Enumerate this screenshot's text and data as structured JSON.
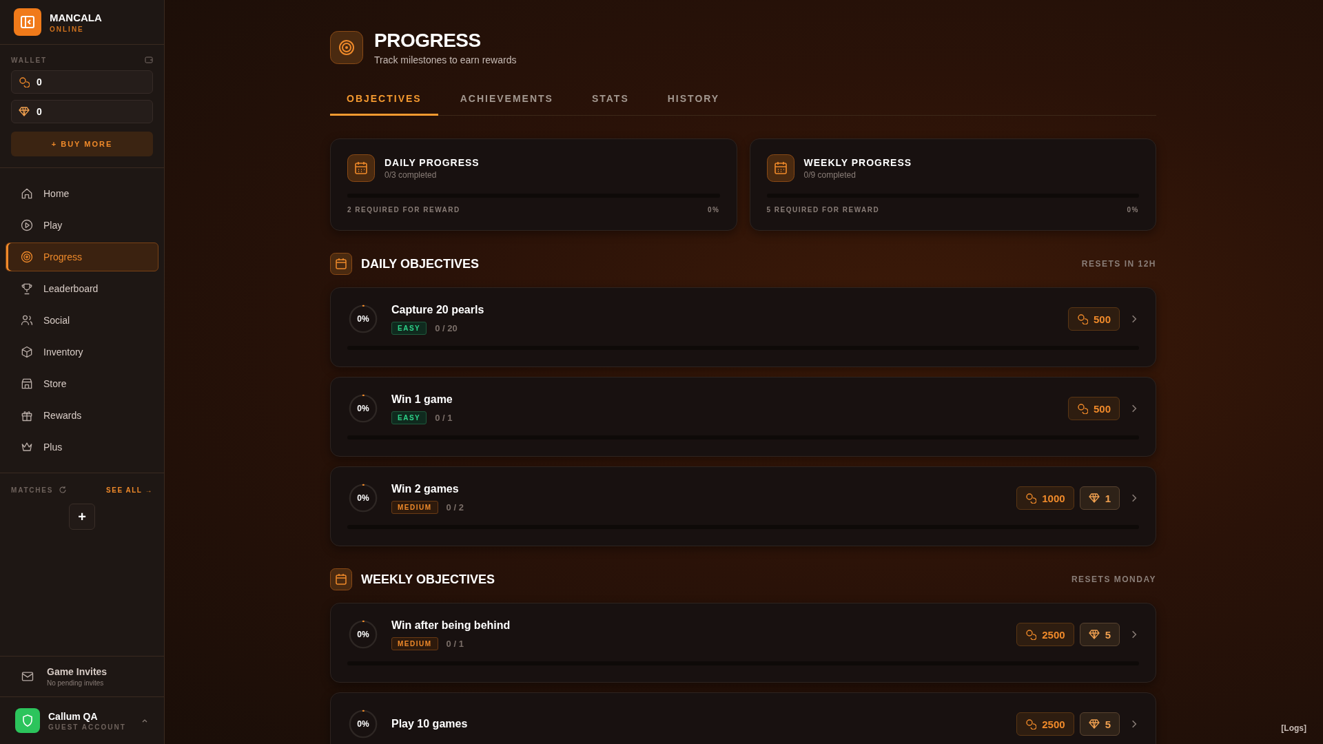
{
  "brand": {
    "name": "MANCALA",
    "status": "ONLINE"
  },
  "wallet": {
    "title": "WALLET",
    "balances": [
      {
        "kind": "coins",
        "amount": "0"
      },
      {
        "kind": "gems",
        "amount": "0"
      }
    ],
    "buy_label": "+ BUY MORE"
  },
  "nav": [
    {
      "label": "Home",
      "selected": false
    },
    {
      "label": "Play",
      "selected": false
    },
    {
      "label": "Progress",
      "selected": true
    },
    {
      "label": "Leaderboard",
      "selected": false
    },
    {
      "label": "Social",
      "selected": false
    },
    {
      "label": "Inventory",
      "selected": false
    },
    {
      "label": "Store",
      "selected": false
    },
    {
      "label": "Rewards",
      "selected": false
    },
    {
      "label": "Plus",
      "selected": false
    }
  ],
  "matches": {
    "title": "MATCHES",
    "see_all": "SEE ALL →",
    "add": "+"
  },
  "invites": {
    "title": "Game Invites",
    "subtitle": "No pending invites"
  },
  "user": {
    "name": "Callum QA",
    "role": "GUEST ACCOUNT"
  },
  "page": {
    "title": "PROGRESS",
    "subtitle": "Track milestones to earn rewards"
  },
  "tabs": [
    {
      "label": "OBJECTIVES",
      "selected": true
    },
    {
      "label": "ACHIEVEMENTS",
      "selected": false
    },
    {
      "label": "STATS",
      "selected": false
    },
    {
      "label": "HISTORY",
      "selected": false
    }
  ],
  "summary": [
    {
      "title": "DAILY PROGRESS",
      "completed": "0/3 completed",
      "level": 0,
      "required": "2 REQUIRED FOR REWARD",
      "percent": "0%"
    },
    {
      "title": "WEEKLY PROGRESS",
      "completed": "0/9 completed",
      "level": 0,
      "required": "5 REQUIRED FOR REWARD",
      "percent": "0%"
    }
  ],
  "sections": [
    {
      "title": "DAILY OBJECTIVES",
      "resets": "RESETS IN 12H",
      "objectives": [
        {
          "title": "Capture 20 pearls",
          "percent": "0%",
          "level": 0,
          "difficulty": {
            "kind": "easy",
            "label": "EASY"
          },
          "count": "0 / 20",
          "rewards": [
            {
              "kind": "coins",
              "amount": "500"
            }
          ]
        },
        {
          "title": "Win 1 game",
          "percent": "0%",
          "level": 0,
          "difficulty": {
            "kind": "easy",
            "label": "EASY"
          },
          "count": "0 / 1",
          "rewards": [
            {
              "kind": "coins",
              "amount": "500"
            }
          ]
        },
        {
          "title": "Win 2 games",
          "percent": "0%",
          "level": 0,
          "difficulty": {
            "kind": "medium",
            "label": "MEDIUM"
          },
          "count": "0 / 2",
          "rewards": [
            {
              "kind": "coins",
              "amount": "1000"
            },
            {
              "kind": "gems",
              "amount": "1"
            }
          ]
        }
      ]
    },
    {
      "title": "WEEKLY OBJECTIVES",
      "resets": "RESETS MONDAY",
      "objectives": [
        {
          "title": "Win after being behind",
          "percent": "0%",
          "level": 0,
          "difficulty": {
            "kind": "medium",
            "label": "MEDIUM"
          },
          "count": "0 / 1",
          "rewards": [
            {
              "kind": "coins",
              "amount": "2500"
            },
            {
              "kind": "gems",
              "amount": "5"
            }
          ]
        },
        {
          "title": "Play 10 games",
          "percent": "0%",
          "level": 0,
          "rewards": [
            {
              "kind": "coins",
              "amount": "2500"
            },
            {
              "kind": "gems",
              "amount": "5"
            }
          ]
        }
      ]
    }
  ],
  "logs": "[Logs]"
}
